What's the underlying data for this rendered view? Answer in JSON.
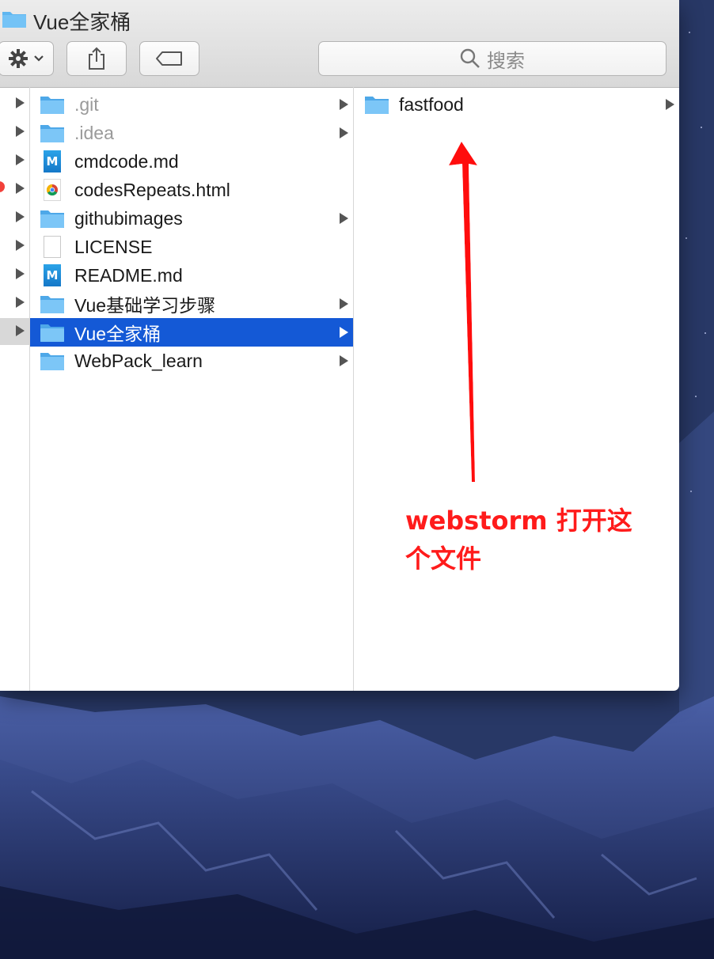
{
  "window": {
    "title": "Vue全家桶",
    "search_placeholder": "搜索"
  },
  "toolbar_icons": [
    "gear-icon",
    "share-icon",
    "tag-icon",
    "search-icon"
  ],
  "column1": {
    "rows": [
      {
        "label": ".git",
        "icon": "folder",
        "dim": true,
        "has_children": true
      },
      {
        "label": ".idea",
        "icon": "folder",
        "dim": true,
        "has_children": true
      },
      {
        "label": "cmdcode.md",
        "icon": "markdown",
        "dim": false,
        "has_children": false
      },
      {
        "label": "codesRepeats.html",
        "icon": "chrome",
        "dim": false,
        "has_children": false
      },
      {
        "label": "githubimages",
        "icon": "folder",
        "dim": false,
        "has_children": true
      },
      {
        "label": "LICENSE",
        "icon": "document",
        "dim": false,
        "has_children": false
      },
      {
        "label": "README.md",
        "icon": "markdown",
        "dim": false,
        "has_children": false
      },
      {
        "label": "Vue基础学习步骤",
        "icon": "folder",
        "dim": false,
        "has_children": true
      },
      {
        "label": "Vue全家桶",
        "icon": "folder",
        "dim": false,
        "has_children": true,
        "selected": true
      },
      {
        "label": "WebPack_learn",
        "icon": "folder",
        "dim": false,
        "has_children": true
      }
    ]
  },
  "column2": {
    "rows": [
      {
        "label": "fastfood",
        "icon": "folder",
        "has_children": true
      }
    ]
  },
  "annotation": {
    "line1": "webstorm 打开这",
    "line2": "个文件",
    "color": "#ff1b1b"
  },
  "colors": {
    "selection": "#1459d6",
    "folder": "#5fb6f0"
  }
}
